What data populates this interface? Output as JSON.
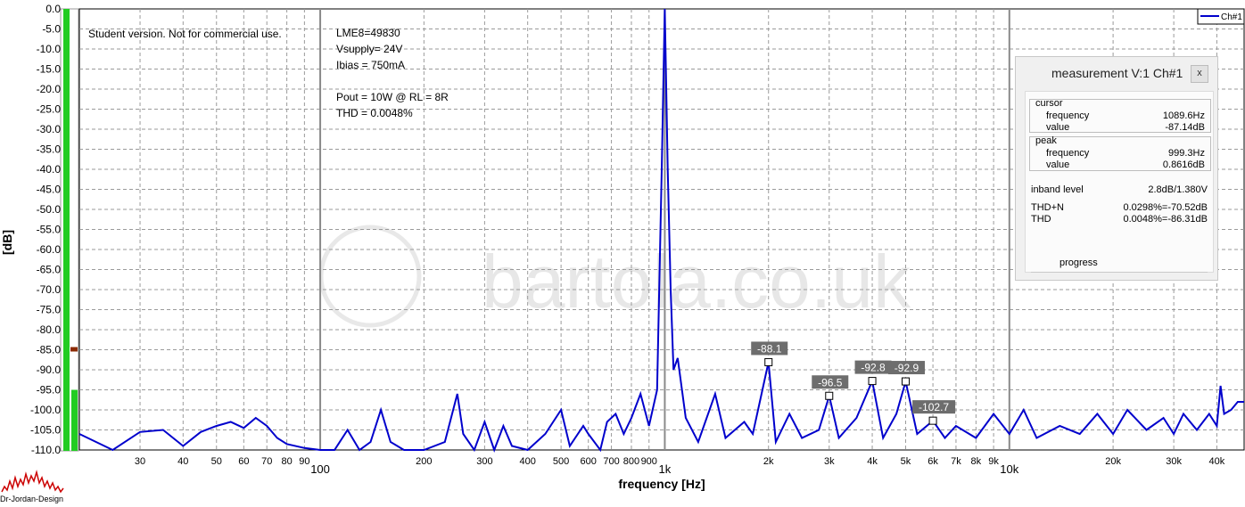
{
  "chart_data": {
    "type": "line",
    "xscale": "log",
    "xlim": [
      20,
      48000
    ],
    "ylim": [
      -110,
      0
    ],
    "ylabel": "[dB]",
    "xlabel": "frequency [Hz]",
    "yticks": [
      "0.0",
      "-5.0",
      "-10.0",
      "-15.0",
      "-20.0",
      "-25.0",
      "-30.0",
      "-35.0",
      "-40.0",
      "-45.0",
      "-50.0",
      "-55.0",
      "-60.0",
      "-65.0",
      "-70.0",
      "-75.0",
      "-80.0",
      "-85.0",
      "-90.0",
      "-95.0",
      "-100.0",
      "-105.0",
      "-110.0"
    ],
    "xticks_minor": [
      "30",
      "40",
      "50",
      "60",
      "70",
      "80",
      "90",
      "200",
      "300",
      "400",
      "500",
      "600",
      "700",
      "800",
      "900",
      "2k",
      "3k",
      "4k",
      "5k",
      "6k",
      "7k",
      "8k",
      "9k",
      "20k",
      "30k",
      "40k"
    ],
    "xticks_major": [
      "100",
      "1k",
      "10k"
    ],
    "grid": true,
    "legend": {
      "entries": [
        "Ch#1"
      ],
      "position": "top-right"
    },
    "series": [
      {
        "name": "Ch#1",
        "color": "#0000cc",
        "points": [
          [
            20,
            -106
          ],
          [
            25,
            -110
          ],
          [
            30,
            -105.5
          ],
          [
            35,
            -105
          ],
          [
            40,
            -109
          ],
          [
            45,
            -105.5
          ],
          [
            50,
            -104
          ],
          [
            55,
            -103
          ],
          [
            60,
            -104.5
          ],
          [
            65,
            -102
          ],
          [
            70,
            -104
          ],
          [
            75,
            -107
          ],
          [
            80,
            -108.5
          ],
          [
            90,
            -109.5
          ],
          [
            100,
            -110
          ],
          [
            110,
            -110
          ],
          [
            120,
            -105
          ],
          [
            130,
            -110
          ],
          [
            140,
            -108
          ],
          [
            150,
            -100
          ],
          [
            160,
            -108
          ],
          [
            175,
            -110
          ],
          [
            190,
            -110
          ],
          [
            200,
            -110
          ],
          [
            230,
            -108
          ],
          [
            250,
            -96
          ],
          [
            260,
            -106
          ],
          [
            280,
            -110
          ],
          [
            300,
            -103
          ],
          [
            320,
            -110
          ],
          [
            340,
            -104
          ],
          [
            360,
            -109
          ],
          [
            400,
            -110
          ],
          [
            450,
            -106
          ],
          [
            500,
            -100
          ],
          [
            530,
            -109
          ],
          [
            580,
            -104
          ],
          [
            600,
            -106
          ],
          [
            650,
            -110
          ],
          [
            680,
            -103
          ],
          [
            720,
            -101
          ],
          [
            760,
            -106
          ],
          [
            800,
            -102
          ],
          [
            850,
            -96
          ],
          [
            900,
            -104
          ],
          [
            950,
            -95
          ],
          [
            980,
            -40
          ],
          [
            1000,
            0.9
          ],
          [
            1020,
            -40
          ],
          [
            1040,
            -70
          ],
          [
            1060,
            -90
          ],
          [
            1090,
            -87.1
          ],
          [
            1150,
            -102
          ],
          [
            1250,
            -108
          ],
          [
            1400,
            -96
          ],
          [
            1500,
            -107
          ],
          [
            1700,
            -103
          ],
          [
            1800,
            -106
          ],
          [
            2000,
            -88.1
          ],
          [
            2100,
            -108
          ],
          [
            2300,
            -101
          ],
          [
            2500,
            -107
          ],
          [
            2800,
            -105
          ],
          [
            3000,
            -96.5
          ],
          [
            3200,
            -107
          ],
          [
            3600,
            -102
          ],
          [
            4000,
            -92.8
          ],
          [
            4300,
            -107
          ],
          [
            4700,
            -101
          ],
          [
            5000,
            -92.9
          ],
          [
            5400,
            -106
          ],
          [
            6000,
            -102.7
          ],
          [
            6500,
            -107
          ],
          [
            7000,
            -104
          ],
          [
            8000,
            -107
          ],
          [
            9000,
            -101
          ],
          [
            10000,
            -106
          ],
          [
            11000,
            -100
          ],
          [
            12000,
            -107
          ],
          [
            14000,
            -104
          ],
          [
            16000,
            -106
          ],
          [
            18000,
            -101
          ],
          [
            20000,
            -106
          ],
          [
            22000,
            -100
          ],
          [
            25000,
            -105
          ],
          [
            28000,
            -102
          ],
          [
            30000,
            -106
          ],
          [
            32000,
            -101
          ],
          [
            35000,
            -105
          ],
          [
            38000,
            -101
          ],
          [
            40000,
            -104
          ],
          [
            41000,
            -94
          ],
          [
            42000,
            -101
          ],
          [
            44000,
            -100
          ],
          [
            46000,
            -98
          ],
          [
            48000,
            -98
          ]
        ]
      }
    ],
    "annotations": [
      {
        "label": "-88.1",
        "x": 2000,
        "y": -88.1
      },
      {
        "label": "-96.5",
        "x": 3000,
        "y": -96.5
      },
      {
        "label": "-92.8",
        "x": 4000,
        "y": -92.8
      },
      {
        "label": "-92.9",
        "x": 5000,
        "y": -92.9
      },
      {
        "label": "-102.7",
        "x": 6000,
        "y": -102.7
      }
    ],
    "notes": [
      "Student version. Not for commercial use."
    ],
    "info_lines": [
      "LME8=49830",
      "Vsupply= 24V",
      "Ibias = 750mA",
      "",
      "Pout = 10W @ RL = 8R",
      "THD = 0.0048%"
    ],
    "level_meter": {
      "bar1_fill_db": -110,
      "bar2_fill_db": -95,
      "marker_db": -85
    }
  },
  "measurement": {
    "title": "measurement V:1 Ch#1",
    "close_label": "x",
    "cursor": {
      "label": "cursor",
      "frequency_label": "frequency",
      "frequency": "1089.6Hz",
      "value_label": "value",
      "value": "-87.14dB"
    },
    "peak": {
      "label": "peak",
      "frequency_label": "frequency",
      "frequency": "999.3Hz",
      "value_label": "value",
      "value": "0.8616dB"
    },
    "inband_label": "inband level",
    "inband": "2.8dB/1.380V",
    "thdn_label": "THD+N",
    "thdn": "0.0298%=-70.52dB",
    "thd_label": "THD",
    "thd": "0.0048%=-86.31dB",
    "progress_label": "progress"
  },
  "watermark": "bartola.co.uk",
  "logo": "Dr-Jordan-Design",
  "colors": {
    "trace": "#0000cc",
    "meter": "#22cc22",
    "marker": "#8b2a00",
    "annotation": "#6d6d6d"
  }
}
